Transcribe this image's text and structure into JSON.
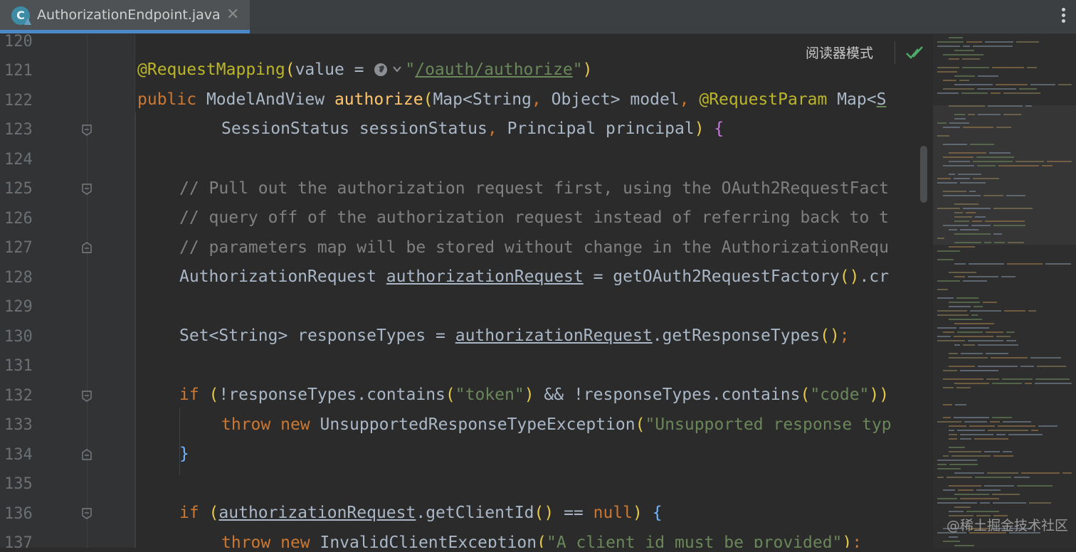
{
  "tab": {
    "icon_letter": "C",
    "file_name": "AuthorizationEndpoint.java",
    "close_glyph": "✕"
  },
  "toolbar": {
    "reader_mode_label": "阅读器模式"
  },
  "line_numbers": [
    "120",
    "121",
    "122",
    "123",
    "124",
    "125",
    "126",
    "127",
    "128",
    "129",
    "130",
    "131",
    "132",
    "133",
    "134",
    "135",
    "136",
    "137"
  ],
  "code": {
    "l121": {
      "annotation": "@RequestMapping",
      "open": "(",
      "key": "value = ",
      "quote_open": "\"",
      "path": "/oauth/authorize",
      "quote_close": "\"",
      "close": ")"
    },
    "l122": {
      "kw": "public ",
      "type": "ModelAndView ",
      "method": "authorize",
      "open": "(",
      "p1": "Map<String",
      "comma1": ", ",
      "p2": "Object> model",
      "comma2": ", ",
      "ann": "@RequestParam",
      "p3": " Map<",
      "p4": "S"
    },
    "l123": {
      "p1": "SessionStatus sessionStatus",
      "comma": ", ",
      "p2": "Principal principal",
      "close": ")",
      "space": " ",
      "brace": "{"
    },
    "l125": "// Pull out the authorization request first, using the OAuth2RequestFact",
    "l126": "// query off of the authorization request instead of referring back to t",
    "l127": "// parameters map will be stored without change in the AuthorizationRequ",
    "l128": {
      "type": "AuthorizationRequest ",
      "var": "authorizationRequest",
      "eq": " = ",
      "call": "getOAuth2RequestFactory",
      "parens": "()",
      "rest": ".cr"
    },
    "l130": {
      "decl": "Set<String> responseTypes = ",
      "var": "authorizationRequest",
      "call": ".getResponseTypes",
      "parens": "()",
      "semi": ";"
    },
    "l132": {
      "kw": "if ",
      "open": "(",
      "p1": "!responseTypes.contains",
      "o2": "(",
      "s1": "\"token\"",
      "c2": ")",
      "and": " && ",
      "p2": "!responseTypes.contains",
      "o3": "(",
      "s2": "\"code\"",
      "c3": ")",
      "close": ")"
    },
    "l133": {
      "kw1": "throw ",
      "kw2": "new ",
      "cls": "UnsupportedResponseTypeException",
      "open": "(",
      "str": "\"Unsupported response typ"
    },
    "l134": "}",
    "l136": {
      "kw": "if ",
      "open": "(",
      "var": "authorizationRequest",
      "call": ".getClientId",
      "parens": "()",
      "op": " == ",
      "null": "null",
      "close": ")",
      "space": " ",
      "brace": "{"
    },
    "l137": {
      "kw1": "throw ",
      "kw2": "new ",
      "cls": "InvalidClientException",
      "open": "(",
      "str": "\"A client id must be provided\"",
      "close": ")",
      "semi": ";"
    }
  },
  "watermark": "@稀土掘金技术社区",
  "colors": {
    "editor_bg": "#2b2b2b",
    "annotation": "#bbb529",
    "keyword": "#cc7832",
    "string": "#6a8759",
    "comment": "#808080",
    "method": "#ffc66d",
    "accent": "#4a88c7"
  },
  "icons": [
    "java-class-icon",
    "close-icon",
    "more-vertical-icon",
    "globe-icon",
    "chevron-down-icon",
    "check-icon",
    "fold-marker-icon"
  ]
}
